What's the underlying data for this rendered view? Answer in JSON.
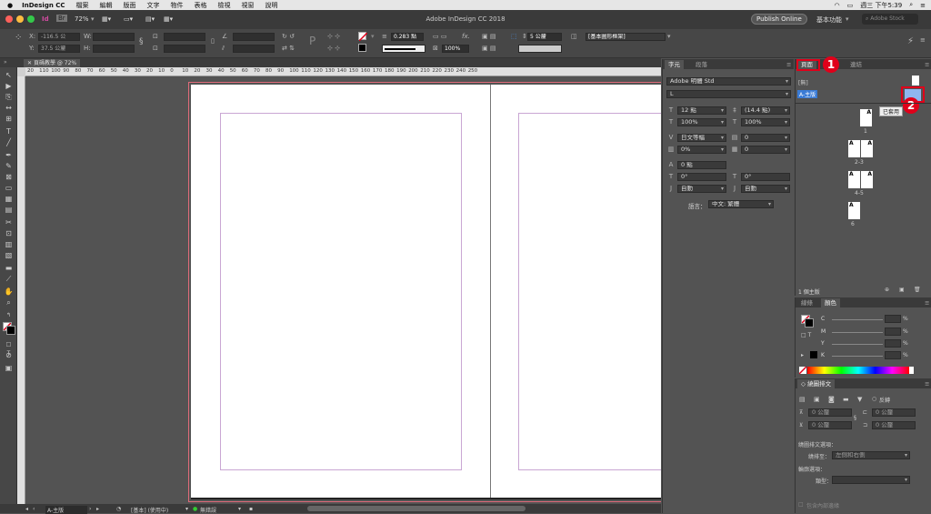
{
  "menubar": {
    "app": "InDesign CC",
    "items": [
      "檔案",
      "編輯",
      "版面",
      "文字",
      "物件",
      "表格",
      "檢視",
      "視窗",
      "說明"
    ],
    "clock": "週三 下午5:39"
  },
  "titlebar": {
    "zoom": "72%",
    "title": "Adobe InDesign CC 2018",
    "publish_button": "Publish Online",
    "workspace": "基本功能",
    "search_placeholder": "Adobe Stock",
    "app_short": "Id",
    "bridge_short": "Br"
  },
  "control": {
    "x_label": "X:",
    "x_value": "-116.5 公",
    "y_label": "Y:",
    "y_value": "37.5 公釐",
    "w_label": "W:",
    "h_label": "H:",
    "stroke_weight": "0.283 點",
    "gap_value": "5 公釐",
    "opacity": "100%",
    "frame_style": "[基本圖形框架]",
    "fx_label": "fx."
  },
  "doc_tab": "頁碼教學 @ 72%",
  "ruler_labels": [
    "20",
    "110",
    "100",
    "90",
    "80",
    "70",
    "60",
    "50",
    "40",
    "30",
    "20",
    "10",
    "0",
    "10",
    "20",
    "30",
    "40",
    "50",
    "60",
    "70",
    "80",
    "90",
    "100",
    "110",
    "120",
    "130",
    "140",
    "150",
    "160",
    "170",
    "180",
    "190",
    "200",
    "210",
    "220",
    "230",
    "240",
    "250"
  ],
  "status": {
    "page": "A-主版",
    "preflight_profile": "[基本] (使用中)",
    "errors": "無錯誤"
  },
  "character_panel": {
    "tab_char": "字元",
    "tab_para": "段落",
    "font": "Adobe 明體 Std",
    "style": "L",
    "size": "12 點",
    "leading": "(14.4 點)",
    "vscale": "100%",
    "hscale": "100%",
    "kerning": "日文等幅",
    "tracking": "0",
    "tsume": "0%",
    "aki": "0",
    "baseline": "0 點",
    "skew": "0°",
    "rotate": "0°",
    "auto1": "自動",
    "auto2": "自動",
    "language_label": "語言：",
    "language": "中文: 繁體"
  },
  "pages_panel": {
    "tab_pages": "頁面",
    "tab_links": "連結",
    "none_master": "[無]",
    "a_master": "A-主版",
    "applied_tooltip": "已套用",
    "page_labels": [
      "1",
      "2-3",
      "4-5",
      "6"
    ],
    "master_letter": "A",
    "footer": "1 個主版",
    "badge1": "1",
    "badge2": "2"
  },
  "color_panel": {
    "tab_stroke": "線條",
    "tab_color": "顏色",
    "channels": [
      "C",
      "M",
      "Y",
      "K"
    ],
    "percent": "%"
  },
  "wrap_panel": {
    "title": "繞圖排文",
    "invert_label": "反轉",
    "unit": "0 公釐",
    "options_label": "繞圖排文選項：",
    "wrap_to_label": "繞排至：",
    "wrap_to_value": "左側和右側",
    "contour_label": "輪廓選項：",
    "type_label": "類型：",
    "include_inside": "包含內部邊緣"
  },
  "colors": {
    "accent_red": "#e0001a",
    "master_highlight": "#3a7bd5"
  }
}
